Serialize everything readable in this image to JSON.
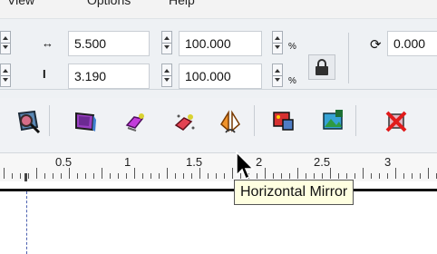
{
  "menu": {
    "items": [
      {
        "label": "View"
      },
      {
        "label": "Options"
      },
      {
        "label": "Help"
      }
    ]
  },
  "properties": {
    "width_value": "5.500",
    "height_value": "3.190",
    "scale_x_value": "100.000",
    "scale_y_value": "100.000",
    "percent_x": "%",
    "percent_y": "%",
    "rotation_value": "0.000"
  },
  "toolbar": {
    "tools": [
      {
        "icon": "envelope-tool-icon"
      },
      {
        "icon": "perspective-tool-icon"
      },
      {
        "icon": "extrude-tool-icon"
      },
      {
        "icon": "blend-tool-icon"
      },
      {
        "icon": "horizontal-mirror-icon"
      },
      {
        "icon": "effects-tool-icon"
      },
      {
        "icon": "bitmap-tool-icon"
      },
      {
        "icon": "delete-effect-icon"
      }
    ]
  },
  "ruler": {
    "labels": [
      "0.5",
      "1",
      "1.5",
      "2",
      "2.5",
      "3"
    ]
  },
  "tooltip": {
    "text": "Horizontal Mirror"
  }
}
